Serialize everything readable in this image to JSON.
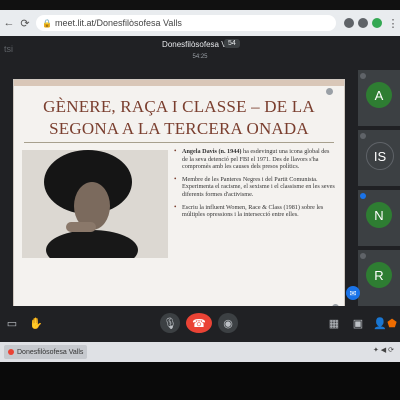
{
  "browser": {
    "url": "meet.lit.at/Donesfilòsofesa Valls",
    "back_icon": "arrow-left-icon",
    "reload_icon": "reload-icon"
  },
  "meeting": {
    "title": "Donesfilòsofesa Valls",
    "participant_count": "54",
    "time": "54:25",
    "left_label": "tsi"
  },
  "slide": {
    "title": "GÈNERE, RAÇA I CLASSE – DE LA SEGONA A LA TERCERA ONADA",
    "bullets": [
      {
        "bold": "Angela Davis (n. 1944)",
        "text": " ha esdevingut una icona global des de la seva detenció pel FBI el 1971. Des de llavors s'ha compromès amb les causes dels presos polítics."
      },
      {
        "bold": "",
        "text": "Membre de les Panteres Negres i del Partit Comunista. Experimenta el racisme, el sexisme i el classisme en les seves diferents formes d'activisme."
      },
      {
        "bold": "",
        "text": "Escriu la influent Women, Race & Class (1981) sobre les múltiples opressions i la intersecció entre elles."
      }
    ],
    "accent_color": "#7a3e2e"
  },
  "participants": [
    {
      "initial": "A",
      "color": "#2e7d32"
    },
    {
      "initial": "IS",
      "color": "#3c4043"
    },
    {
      "initial": "N",
      "color": "#2e7d32"
    },
    {
      "initial": "R",
      "color": "#2e7d32"
    }
  ],
  "controls": {
    "items": [
      "chat-icon",
      "hand-icon",
      "mic-off-icon",
      "hangup-icon",
      "camera-icon",
      "grid-icon",
      "tiles-icon",
      "participants-icon",
      "settings-icon"
    ]
  },
  "taskbar": {
    "app_label": "Donesfilòsofesa Valls",
    "tray_text": "✦ ◀ ⟳"
  },
  "colors": {
    "meet_bg": "#202124",
    "hangup": "#ea4335",
    "brand_blue": "#1a73e8"
  }
}
